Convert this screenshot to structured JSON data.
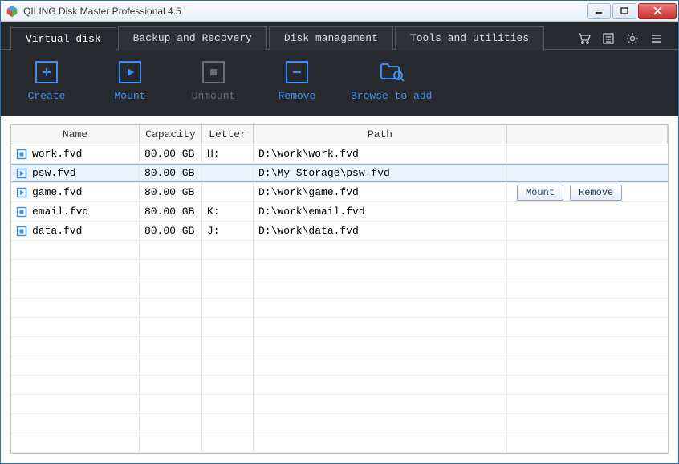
{
  "window": {
    "title": "QILING Disk Master Professional 4.5"
  },
  "tabs": [
    {
      "label": "Virtual disk",
      "active": true
    },
    {
      "label": "Backup and Recovery",
      "active": false
    },
    {
      "label": "Disk management",
      "active": false
    },
    {
      "label": "Tools and utilities",
      "active": false
    }
  ],
  "toolbar": [
    {
      "label": "Create",
      "style": "blue",
      "iconGlyph": "plus"
    },
    {
      "label": "Mount",
      "style": "blue",
      "iconGlyph": "play"
    },
    {
      "label": "Unmount",
      "style": "gray",
      "iconGlyph": "stop"
    },
    {
      "label": "Remove",
      "style": "blue",
      "iconGlyph": "minus"
    },
    {
      "label": "Browse to add",
      "style": "blue",
      "iconGlyph": "browse"
    }
  ],
  "columns": {
    "name": "Name",
    "capacity": "Capacity",
    "letter": "Letter",
    "path": "Path"
  },
  "rows": [
    {
      "name": "work.fvd",
      "capacity": "80.00 GB",
      "letter": "H:",
      "path": "D:\\work\\work.fvd",
      "selected": false,
      "mounted": true,
      "showActions": false
    },
    {
      "name": "psw.fvd",
      "capacity": "80.00 GB",
      "letter": "",
      "path": "D:\\My Storage\\psw.fvd",
      "selected": true,
      "mounted": false,
      "showActions": false
    },
    {
      "name": "game.fvd",
      "capacity": "80.00 GB",
      "letter": "",
      "path": "D:\\work\\game.fvd",
      "selected": false,
      "mounted": false,
      "showActions": true
    },
    {
      "name": "email.fvd",
      "capacity": "80.00 GB",
      "letter": "K:",
      "path": "D:\\work\\email.fvd",
      "selected": false,
      "mounted": true,
      "showActions": false
    },
    {
      "name": "data.fvd",
      "capacity": "80.00 GB",
      "letter": "J:",
      "path": "D:\\work\\data.fvd",
      "selected": false,
      "mounted": true,
      "showActions": false
    }
  ],
  "actions": {
    "mount": "Mount",
    "remove": "Remove"
  },
  "colors": {
    "accent": "#3e8ff0",
    "disabled": "#6a6e74"
  }
}
